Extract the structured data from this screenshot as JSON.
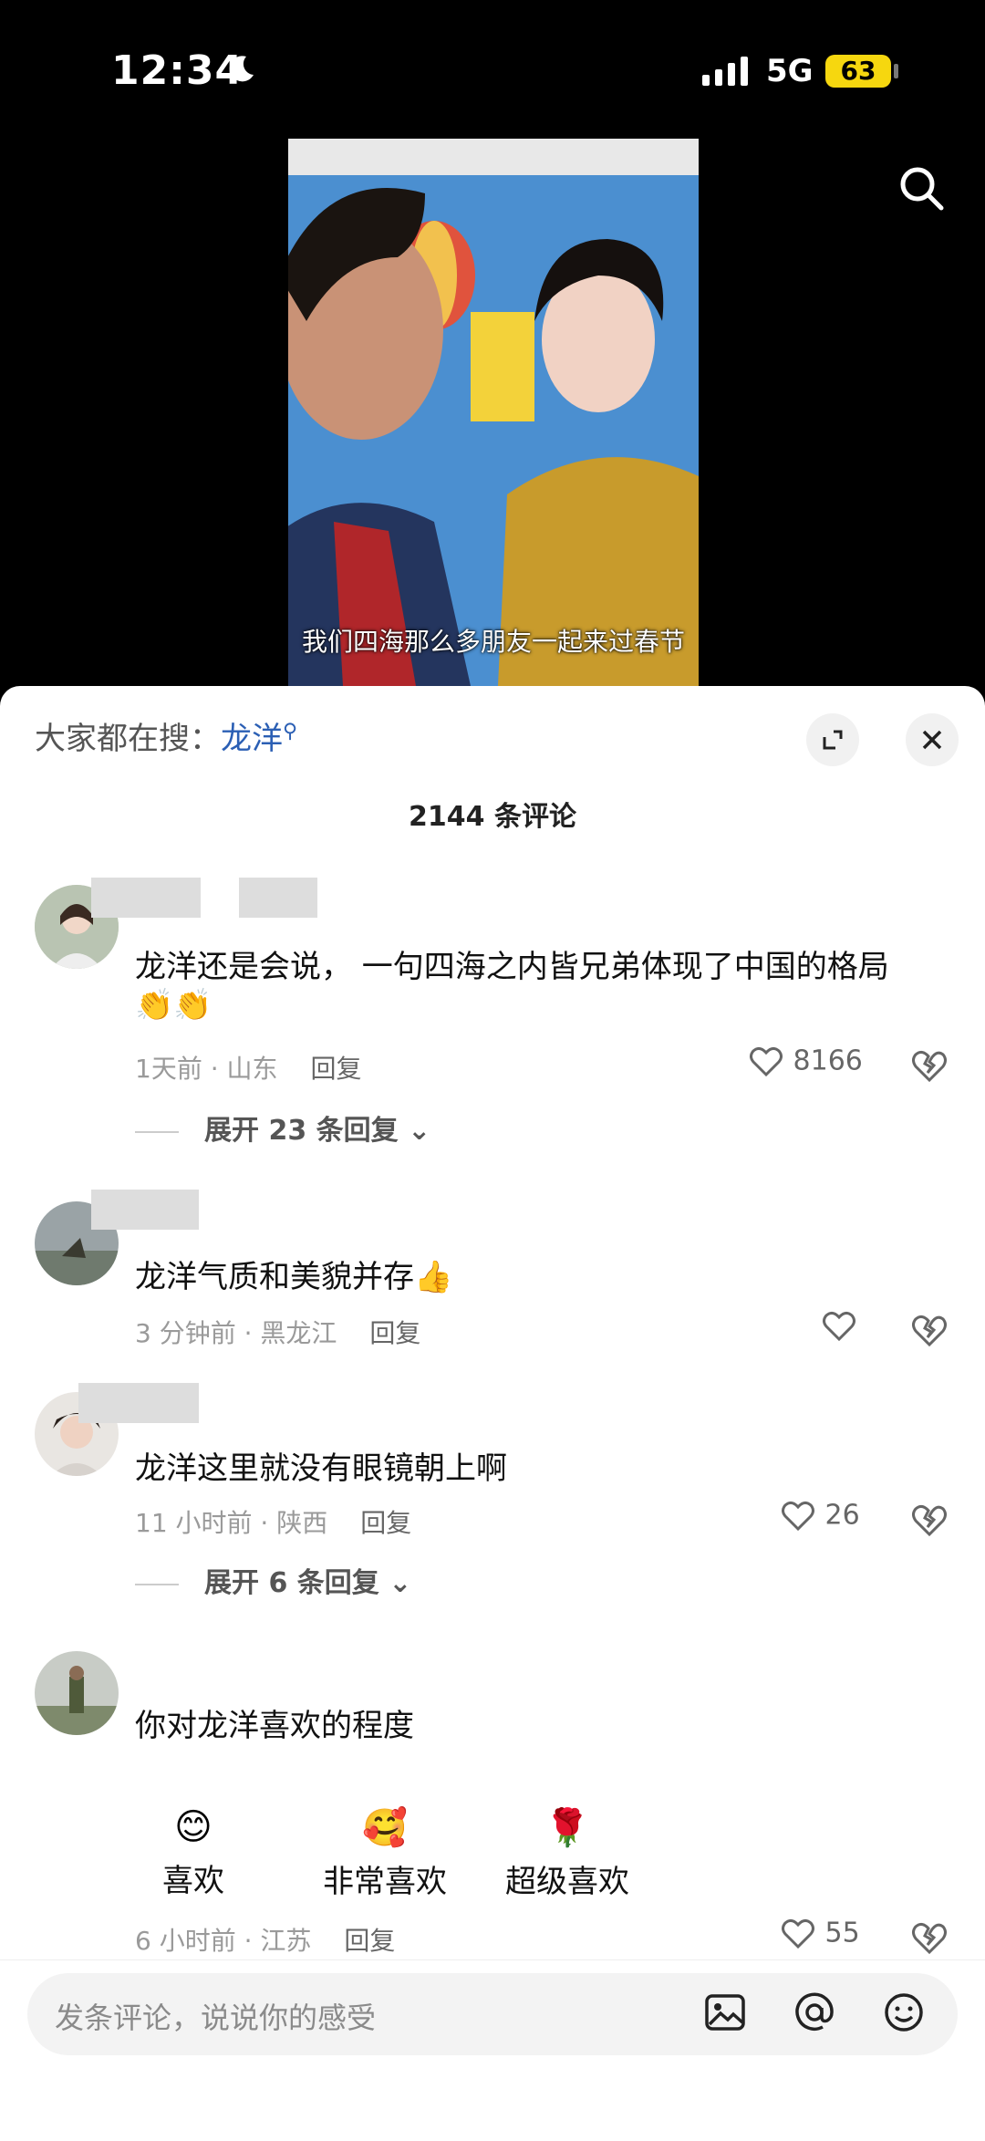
{
  "status": {
    "time": "12:34",
    "network": "5G",
    "battery": "63"
  },
  "video": {
    "subtitle": "我们四海那么多朋友一起来过春节"
  },
  "sheet": {
    "hot_search_prefix": "大家都在搜：",
    "hot_search_keyword": "龙洋",
    "comment_count": "2144 条评论"
  },
  "comments": [
    {
      "text": "龙洋还是会说， 一句四海之内皆兄弟体现了中国的格局",
      "emoji": "👏👏",
      "time": "1天前 · 山东",
      "reply": "回复",
      "likes": "8166",
      "expand": "展开 23 条回复"
    },
    {
      "text": "龙洋气质和美貌并存👍",
      "time": "3 分钟前 · 黑龙江",
      "reply": "回复",
      "likes": ""
    },
    {
      "text": "龙洋这里就没有眼镜朝上啊",
      "time": "11 小时前 · 陕西",
      "reply": "回复",
      "likes": "26",
      "expand": "展开 6 条回复"
    },
    {
      "text": "你对龙洋喜欢的程度",
      "time": "6 小时前 · 江苏",
      "reply": "回复",
      "likes": "55",
      "poll": [
        {
          "icon": "😊",
          "label": "喜欢"
        },
        {
          "icon": "🥰",
          "label": "非常喜欢"
        },
        {
          "icon": "🌹",
          "label": "超级喜欢"
        }
      ]
    }
  ],
  "input": {
    "placeholder": "发条评论，说说你的感受"
  }
}
